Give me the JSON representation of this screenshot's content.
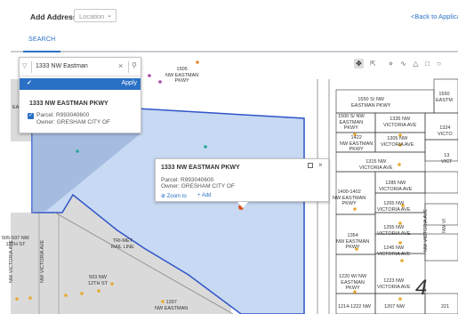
{
  "header": {
    "add_address_label": "Add Address As",
    "location_select": "Location",
    "back_link": "<Back to Applica"
  },
  "tabs": {
    "search": "SEARCH"
  },
  "search": {
    "value": "1333 NW Eastman",
    "apply": "Apply",
    "result_name": "1333 NW EASTMAN PKWY",
    "result_parcel": "Parcel: R993040600",
    "result_owner": "Owner: GRESHAM CITY OF"
  },
  "popup": {
    "title": "1333 NW EASTMAN PKWY",
    "parcel": "Parcel: R993040600",
    "owner": "Owner: GRESHAM CITY OF",
    "zoom": "Zoom to",
    "add": "Add"
  },
  "page_number": "4",
  "map_labels": {
    "l1505": [
      "1505",
      "NW EASTMAN",
      "PKWY"
    ],
    "l1550": [
      "1550 S/ NW",
      "EASTMAN PKWY"
    ],
    "l1550b": [
      "1550",
      "EASTM"
    ],
    "l1500": [
      "1500 S/ NW",
      "EASTMAN",
      "PKWY"
    ],
    "l1335": [
      "1335 NW",
      "VICTORIA AVE"
    ],
    "l1324": [
      "1324",
      "VICTO"
    ],
    "l1422": [
      "1422",
      "NW EASTMAN",
      "PKWY"
    ],
    "l1305": [
      "1305 NW",
      "VICTORIA AVE"
    ],
    "l13x": [
      "13",
      "VICT"
    ],
    "l1315": [
      "1315 NW",
      "VICTORIA AVE"
    ],
    "l1285": [
      "1285 NW",
      "VICTORIA AVE"
    ],
    "l1400": [
      "1400-1402",
      "NW EASTMAN",
      "PKWY"
    ],
    "l1265": [
      "1265 NW",
      "VICTORIA AVE"
    ],
    "l1255": [
      "1255 NW",
      "VICTORIA AVE"
    ],
    "l1354": [
      "1354",
      "NW EASTMAN",
      "PKWY"
    ],
    "l1245": [
      "1245 NW",
      "VICTORIA AVE"
    ],
    "l1220": [
      "1220 W/ NW",
      "EASTMAN",
      "PKWY"
    ],
    "l1223": [
      "1223 NW",
      "VICTORIA AVE"
    ],
    "l1214": [
      "1214-1222 NW"
    ],
    "l1207": [
      "1207 NW"
    ],
    "l221": [
      "221"
    ],
    "l505": [
      "505-597 NW",
      "12TH ST"
    ],
    "trimet": [
      "TRI-MET",
      "RAIL LINE"
    ],
    "l503": [
      "503 NW",
      "12TH ST"
    ],
    "l1297": [
      "1297",
      "NW EASTMAN"
    ],
    "victoria_street": [
      "NW VICTORIA AVE"
    ],
    "victoria_street2": [
      "NW VI"
    ],
    "rail_street": [
      "NW VICTORIA AVE"
    ],
    "ea_fragment": [
      "EA"
    ]
  },
  "icons": [
    "filter-icon",
    "clear-icon",
    "search-icon",
    "checkmark-icon",
    "maximize-icon",
    "close-icon",
    "zoom-icon",
    "add-icon",
    "pan-icon",
    "select-icon",
    "measure-icon",
    "polyline-icon",
    "polygon-icon",
    "rectangle-icon",
    "circle-icon"
  ],
  "colors": {
    "accent": "#2a70c5",
    "parcel_fill": "#c8d9f3",
    "parcel_border": "#2f55c8",
    "gray_parcel": "#dadada"
  }
}
